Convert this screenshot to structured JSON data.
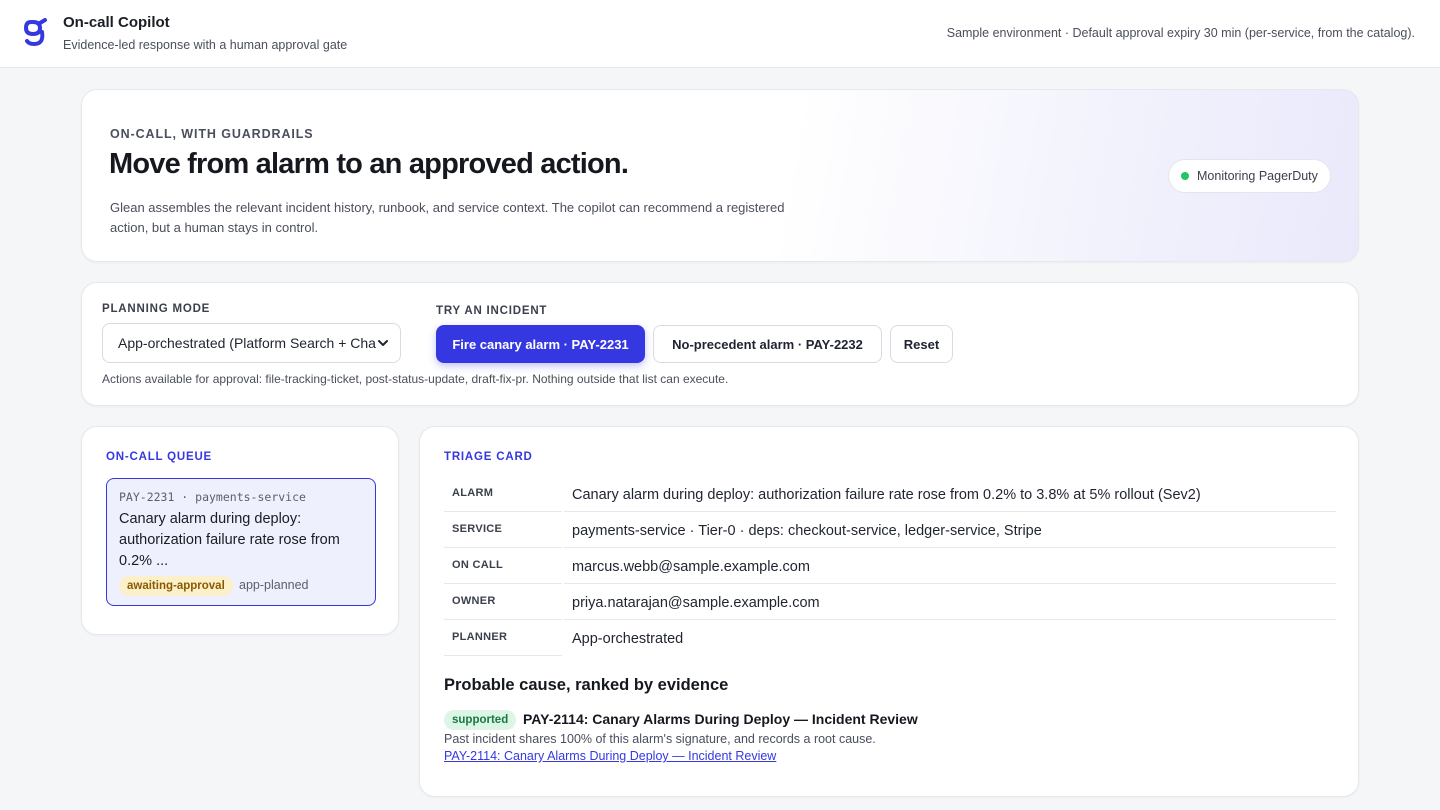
{
  "header": {
    "app_title": "On-call Copilot",
    "app_subtitle": "Evidence-led response with a human approval gate",
    "env_note": "Sample environment · Default approval expiry 30 min (per-service, from the catalog)."
  },
  "hero": {
    "eyebrow": "ON-CALL, WITH GUARDRAILS",
    "title": "Move from alarm to an approved action.",
    "description": "Glean assembles the relevant incident history, runbook, and service context. The copilot can recommend a registered action, but a human stays in control.",
    "status_pill": "Monitoring PagerDuty"
  },
  "controls": {
    "planning_mode_label": "PLANNING MODE",
    "planning_mode_value": "App-orchestrated (Platform Search + Chat)",
    "try_incident_label": "TRY AN INCIDENT",
    "buttons": {
      "fire": "Fire canary alarm · PAY-2231",
      "no_precedent": "No-precedent alarm · PAY-2232",
      "reset": "Reset"
    },
    "actions_note": "Actions available for approval: file-tracking-ticket, post-status-update, draft-fix-pr. Nothing outside that list can execute."
  },
  "queue": {
    "label": "ON-CALL QUEUE",
    "items": [
      {
        "id_line": "PAY-2231 · payments-service",
        "title": "Canary alarm during deploy: authorization failure rate rose from 0.2% ...",
        "status": "awaiting-approval",
        "planner": "app-planned"
      }
    ]
  },
  "triage": {
    "label": "TRIAGE CARD",
    "rows": [
      {
        "key": "ALARM",
        "value": "Canary alarm during deploy: authorization failure rate rose from 0.2% to 3.8% at 5% rollout (Sev2)"
      },
      {
        "key": "SERVICE",
        "value": "payments-service · Tier-0 · deps: checkout-service, ledger-service, Stripe"
      },
      {
        "key": "ON CALL",
        "value": "marcus.webb@sample.example.com"
      },
      {
        "key": "OWNER",
        "value": "priya.natarajan@sample.example.com"
      },
      {
        "key": "PLANNER",
        "value": "App-orchestrated"
      }
    ],
    "cause_title": "Probable cause, ranked by evidence",
    "cause": {
      "badge": "supported",
      "name": "PAY-2114: Canary Alarms During Deploy — Incident Review",
      "description": "Past incident shares 100% of this alarm's signature, and records a root cause.",
      "link": "PAY-2114: Canary Alarms During Deploy — Incident Review"
    }
  },
  "colors": {
    "accent": "#3538e0",
    "status_green": "#22c55e",
    "badge_awaiting_bg": "#fbf0c9",
    "badge_supported_bg": "#ddf5e6"
  }
}
